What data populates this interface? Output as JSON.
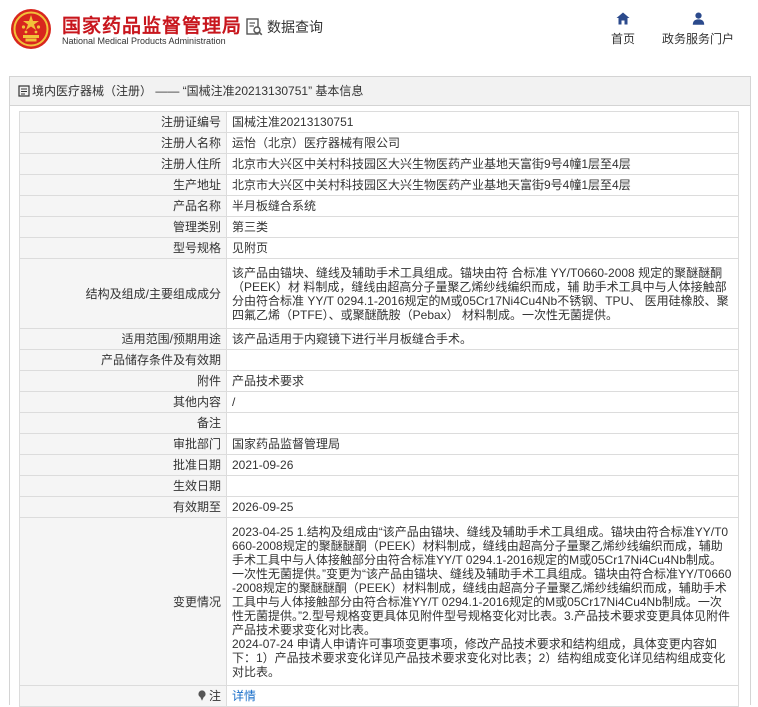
{
  "header": {
    "brand_cn": "国家药品监督管理局",
    "brand_en": "National Medical Products Administration",
    "query_label": "数据查询",
    "nav": [
      {
        "label": "首页",
        "icon": "home-icon"
      },
      {
        "label": "政务服务门户",
        "icon": "user-icon"
      }
    ]
  },
  "breadcrumb": {
    "text": "境内医疗器械（注册） —— “国械注准20213130751” 基本信息"
  },
  "record": {
    "rows": [
      {
        "key": "注册证编号",
        "value": "国械注准20213130751"
      },
      {
        "key": "注册人名称",
        "value": "运怡（北京）医疗器械有限公司"
      },
      {
        "key": "注册人住所",
        "value": "北京市大兴区中关村科技园区大兴生物医药产业基地天富街9号4幢1层至4层"
      },
      {
        "key": "生产地址",
        "value": "北京市大兴区中关村科技园区大兴生物医药产业基地天富街9号4幢1层至4层"
      },
      {
        "key": "产品名称",
        "value": "半月板缝合系统"
      },
      {
        "key": "管理类别",
        "value": "第三类"
      },
      {
        "key": "型号规格",
        "value": "见附页"
      },
      {
        "key": "结构及组成/主要组成成分",
        "value": "该产品由锚块、缝线及辅助手术工具组成。锚块由符 合标准 YY/T0660-2008 规定的聚醚醚酮（PEEK）材 料制成，缝线由超高分子量聚乙烯纱线编织而成，辅 助手术工具中与人体接触部分由符合标准 YY/T 0294.1-2016规定的M或05Cr17Ni4Cu4Nb不锈钢、TPU、 医用硅橡胶、聚四氟乙烯（PTFE）、或聚醚酰胺（Pebax） 材料制成。一次性无菌提供。"
      },
      {
        "key": "适用范围/预期用途",
        "value": "该产品适用于内窥镜下进行半月板缝合手术。"
      },
      {
        "key": "产品储存条件及有效期",
        "value": ""
      },
      {
        "key": "附件",
        "value": "产品技术要求"
      },
      {
        "key": "其他内容",
        "value": "/"
      },
      {
        "key": "备注",
        "value": ""
      },
      {
        "key": "审批部门",
        "value": "国家药品监督管理局"
      },
      {
        "key": "批准日期",
        "value": "2021-09-26"
      },
      {
        "key": "生效日期",
        "value": ""
      },
      {
        "key": "有效期至",
        "value": "2026-09-25"
      },
      {
        "key": "变更情况",
        "value": "2023-04-25 1.结构及组成由“该产品由锚块、缝线及辅助手术工具组成。锚块由符合标准YY/T0660-2008规定的聚醚醚酮（PEEK）材料制成，缝线由超高分子量聚乙烯纱线编织而成，辅助手术工具中与人体接触部分由符合标准YY/T 0294.1-2016规定的M或05Cr17Ni4Cu4Nb制成。一次性无菌提供。”变更为“该产品由锚块、缝线及辅助手术工具组成。锚块由符合标准YY/T0660-2008规定的聚醚醚酮（PEEK）材料制成，缝线由超高分子量聚乙烯纱线编织而成，辅助手术工具中与人体接触部分由符合标准YY/T 0294.1-2016规定的M或05Cr17Ni4Cu4Nb制成。一次性无菌提供。”2.型号规格变更具体见附件型号规格变化对比表。3.产品技术要求变更具体见附件产品技术要求变化对比表。\n2024-07-24 申请人申请许可事项变更事项，修改产品技术要求和结构组成，具体变更内容如下：1）产品技术要求变化详见产品技术要求变化对比表；2）结构组成变化详见结构组成变化对比表。"
      }
    ],
    "note": {
      "key": "注",
      "value": "详情",
      "icon": "pin-icon"
    }
  }
}
